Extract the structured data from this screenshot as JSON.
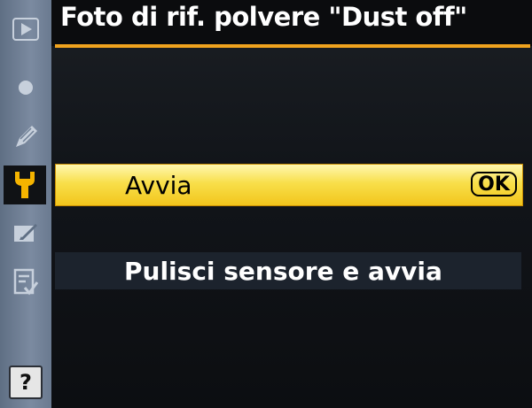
{
  "header": {
    "title": "Foto di rif. polvere \"Dust off\""
  },
  "sidebar": {
    "items": [
      {
        "icon": "playback-icon",
        "active": false
      },
      {
        "icon": "camera-shooting-icon",
        "active": false
      },
      {
        "icon": "custom-settings-pencil-icon",
        "active": false
      },
      {
        "icon": "wrench-setup-icon",
        "active": true
      },
      {
        "icon": "retouch-icon",
        "active": false
      },
      {
        "icon": "my-menu-icon",
        "active": false
      }
    ],
    "help_label": "?"
  },
  "menu": {
    "items": [
      {
        "label": "Avvia",
        "selected": true,
        "badge": "OK"
      },
      {
        "label": "Pulisci sensore e avvia",
        "selected": false
      }
    ]
  },
  "colors": {
    "accent": "#f0a31e",
    "selected_bg": "#f5d33a",
    "sidebar_bg": "#6f7f95",
    "active_icon": "#f5b400"
  }
}
